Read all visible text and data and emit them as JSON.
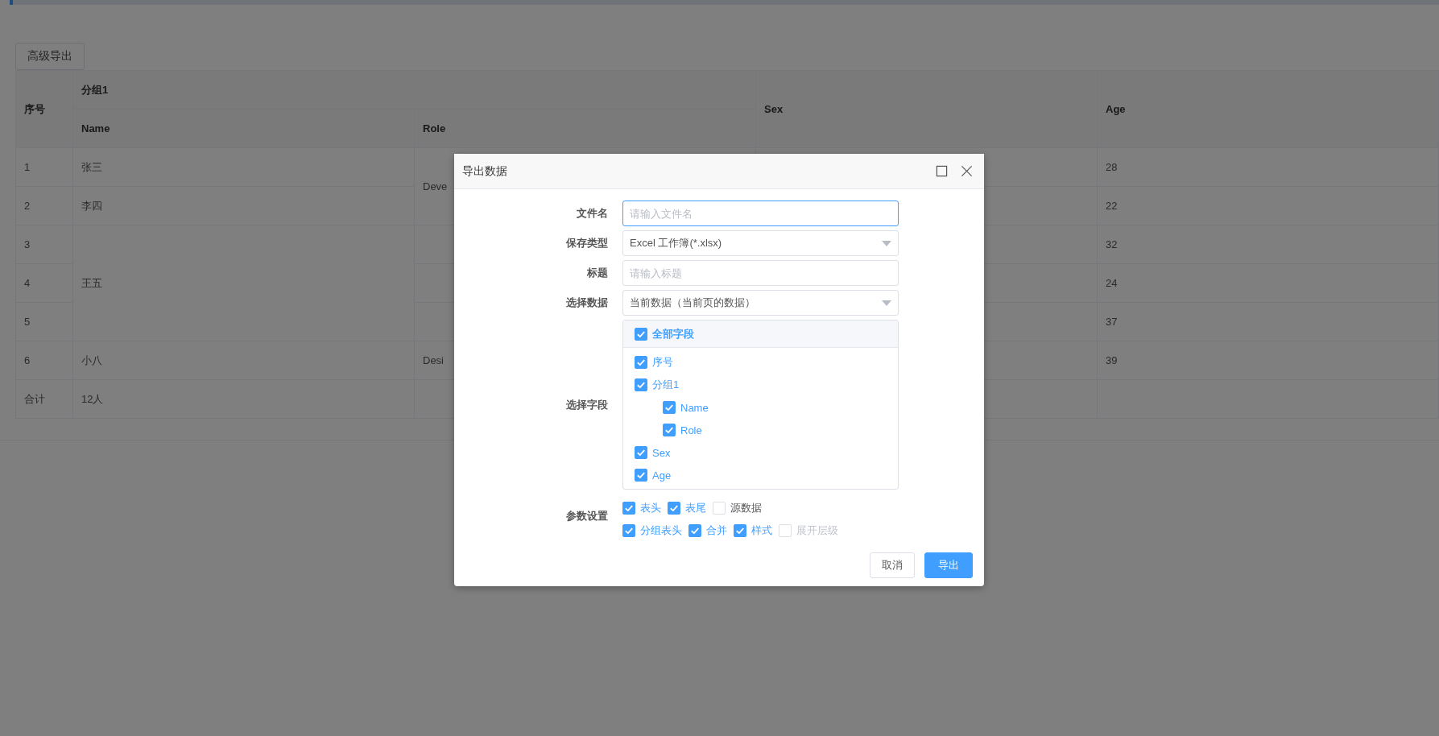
{
  "toolbar": {
    "export_button": "高级导出"
  },
  "table": {
    "header": {
      "index": "序号",
      "group": "分组1",
      "name": "Name",
      "role": "Role",
      "sex": "Sex",
      "age": "Age"
    },
    "rows": [
      {
        "index": "1",
        "name": "张三",
        "role": "Deve",
        "age": "28"
      },
      {
        "index": "2",
        "name": "李四",
        "role_merged_with_above": true,
        "age": "22"
      },
      {
        "index": "3",
        "name": "王五",
        "age": "32"
      },
      {
        "index": "4",
        "name_merged_with_above": true,
        "age": "24"
      },
      {
        "index": "5",
        "name_merged_with_above": true,
        "age": "37"
      },
      {
        "index": "6",
        "name": "小八",
        "role": "Desi",
        "age": "39"
      }
    ],
    "footer": {
      "index": "合计",
      "name": "12人"
    }
  },
  "dialog": {
    "title": "导出数据",
    "fields": [
      {
        "kind": "input",
        "label": "文件名",
        "placeholder": "请输入文件名",
        "focused": true
      },
      {
        "kind": "select",
        "label": "保存类型",
        "value": "Excel 工作簿(*.xlsx)",
        "focused": false
      },
      {
        "kind": "input",
        "label": "标题",
        "placeholder": "请输入标题",
        "focused": false
      },
      {
        "kind": "select",
        "label": "选择数据",
        "value": "当前数据（当前页的数据）",
        "focused": false
      }
    ],
    "field_picker": {
      "label": "选择字段",
      "all": {
        "label": "全部字段",
        "checked": true
      },
      "items": [
        {
          "label": "序号",
          "checked": true
        },
        {
          "label": "分组1",
          "checked": true,
          "children": [
            {
              "label": "Name",
              "checked": true
            },
            {
              "label": "Role",
              "checked": true
            }
          ]
        },
        {
          "label": "Sex",
          "checked": true
        },
        {
          "label": "Age",
          "checked": true
        }
      ]
    },
    "options": {
      "label": "参数设置",
      "rows": [
        [
          {
            "label": "表头",
            "checked": true,
            "disabled": false
          },
          {
            "label": "表尾",
            "checked": true,
            "disabled": false
          },
          {
            "label": "源数据",
            "checked": false,
            "disabled": false
          }
        ],
        [
          {
            "label": "分组表头",
            "checked": true,
            "disabled": false
          },
          {
            "label": "合并",
            "checked": true,
            "disabled": false
          },
          {
            "label": "样式",
            "checked": true,
            "disabled": false
          },
          {
            "label": "展开层级",
            "checked": false,
            "disabled": true
          }
        ]
      ]
    },
    "buttons": [
      {
        "label": "取消",
        "kind": "default"
      },
      {
        "label": "导出",
        "kind": "primary"
      }
    ]
  }
}
